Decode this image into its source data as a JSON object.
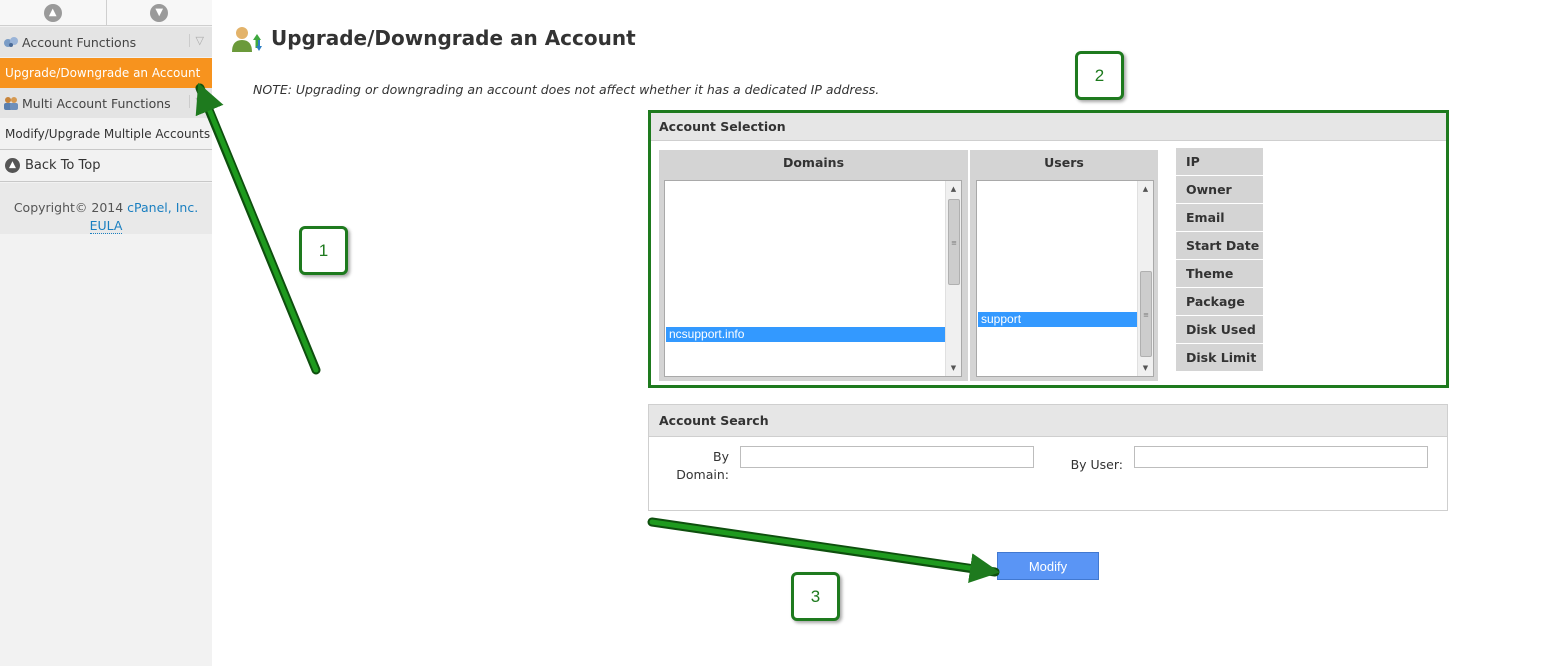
{
  "sidebar": {
    "categories": [
      {
        "label": "Account Functions"
      },
      {
        "label": "Multi Account Functions"
      }
    ],
    "items": [
      {
        "label": "Upgrade/Downgrade an Account"
      },
      {
        "label": "Modify/Upgrade Multiple Accounts"
      }
    ],
    "back_to_top": "Back To Top",
    "copyright_prefix": "Copyright© 2014",
    "copyright_link": "cPanel, Inc.",
    "eula": "EULA"
  },
  "page": {
    "title": "Upgrade/Downgrade an Account",
    "note": "NOTE: Upgrading or downgrading an account does not affect whether it has a dedicated IP address."
  },
  "account_selection": {
    "header": "Account Selection",
    "domains_header": "Domains",
    "users_header": "Users",
    "selected_domain": "ncsupport.info",
    "selected_user": "support",
    "info_labels": [
      "IP",
      "Owner",
      "Email",
      "Start Date",
      "Theme",
      "Package",
      "Disk Used",
      "Disk Limit"
    ]
  },
  "account_search": {
    "header": "Account Search",
    "by_domain_label_1": "By",
    "by_domain_label_2": "Domain:",
    "by_user_label": "By User:",
    "domain_value": "",
    "user_value": ""
  },
  "modify_button": "Modify",
  "callouts": [
    "1",
    "2",
    "3"
  ],
  "colors": {
    "active_orange": "#f7931e",
    "annotation_green": "#1e7a1e",
    "button_blue": "#5a95f5",
    "selection_blue": "#3399ff"
  }
}
